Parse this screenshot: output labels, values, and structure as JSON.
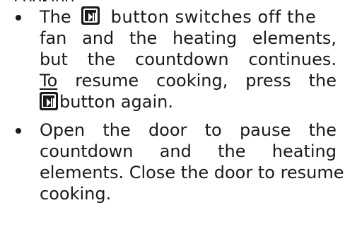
{
  "top_fragment": "cooking",
  "bullets": [
    {
      "line1_a": "The",
      "line1_b": "button switches off the",
      "line2": [
        "fan",
        "and",
        "the",
        "heating",
        "elements,"
      ],
      "line3": [
        "but",
        "the",
        "countdown",
        "continues."
      ],
      "line4": [
        "To",
        "resume",
        "cooking,",
        "press",
        "the"
      ],
      "line5": "button again.",
      "icon": "start-pause-icon"
    },
    {
      "line1": [
        "Open",
        "the",
        "door",
        "to",
        "pause",
        "the"
      ],
      "line2": [
        "countdown",
        "and",
        "the",
        "heating"
      ],
      "line3": "elements. Close the door to resume",
      "line4": "cooking."
    }
  ]
}
